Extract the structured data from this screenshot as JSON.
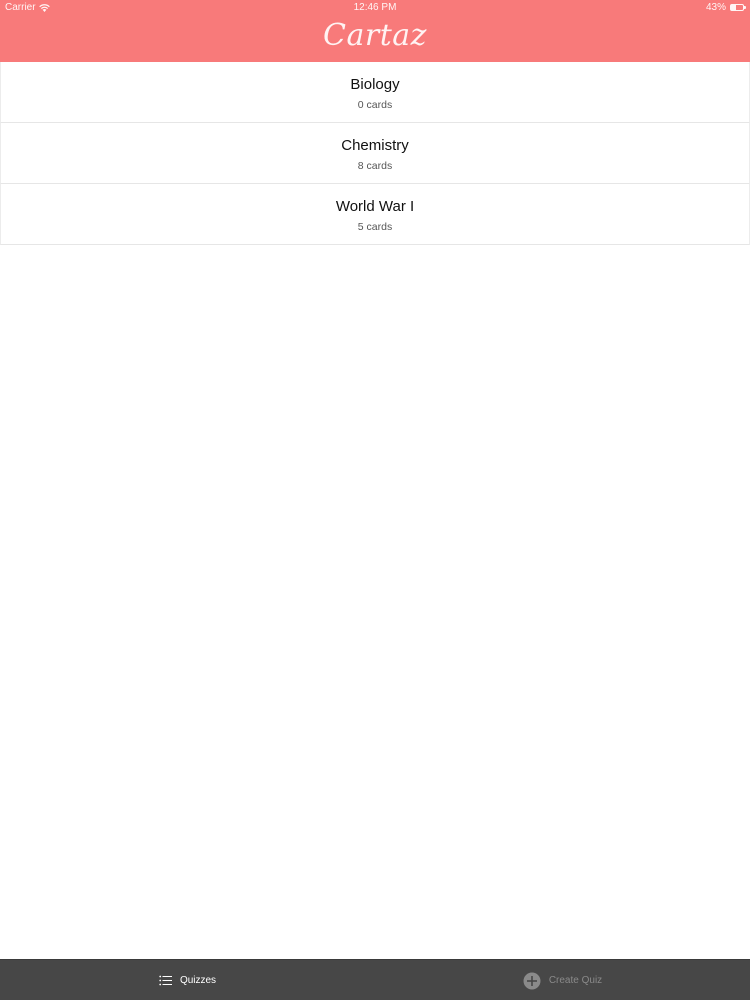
{
  "status_bar": {
    "carrier": "Carrier",
    "time": "12:46 PM",
    "battery": "43%",
    "battery_level": 0.43,
    "wifi_icon": "wifi-icon",
    "battery_icon": "battery-icon"
  },
  "nav": {
    "title": "Cartaz"
  },
  "quizzes": [
    {
      "name": "Biology",
      "count": "0 cards"
    },
    {
      "name": "Chemistry",
      "count": "8 cards"
    },
    {
      "name": "World War I",
      "count": "5 cards"
    }
  ],
  "tab_bar": {
    "quizzes": {
      "label": "Quizzes",
      "icon": "list-icon",
      "selected": true
    },
    "create": {
      "label": "Create Quiz",
      "icon": "plus-circle-icon",
      "selected": false
    }
  },
  "colors": {
    "header": "#f87a7a",
    "tab_bar": "#474747",
    "tab_selected": "#ffffff",
    "tab_unselected": "#8a8a8a"
  }
}
